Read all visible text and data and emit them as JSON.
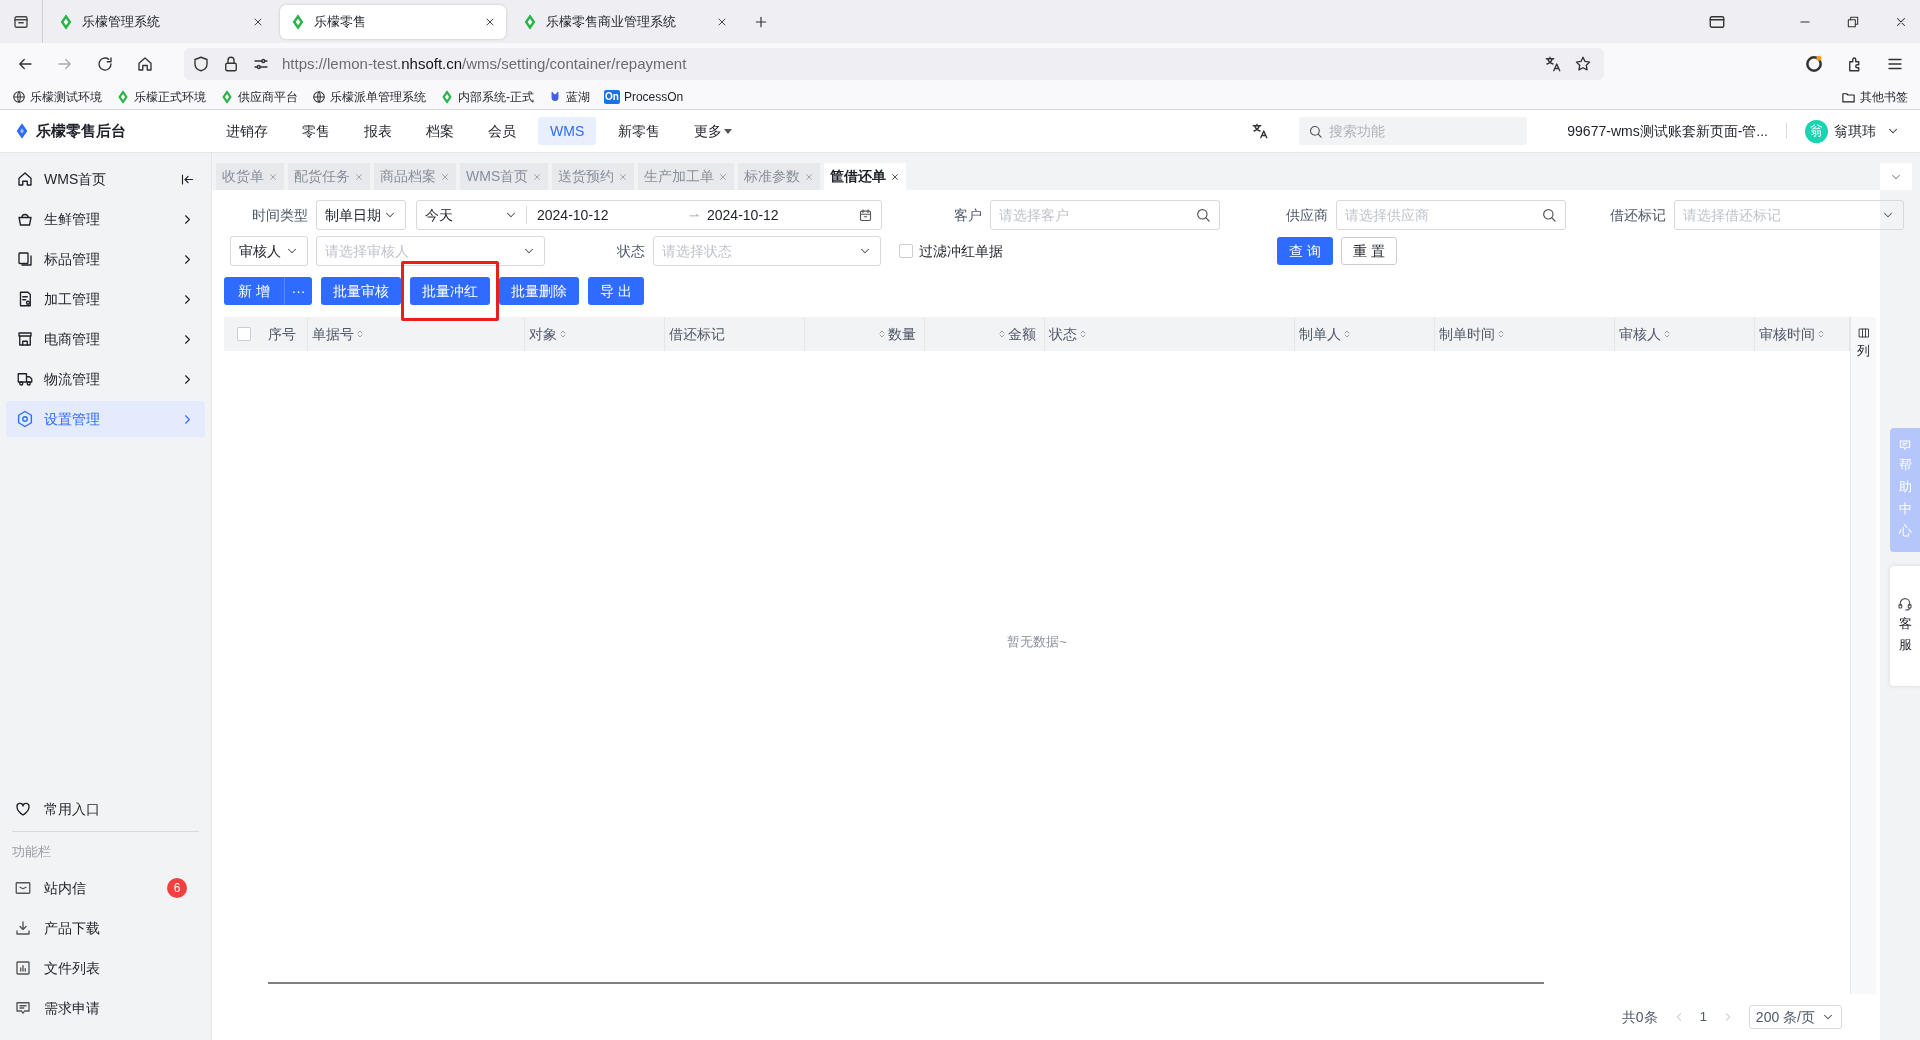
{
  "browser": {
    "tabs": [
      {
        "title": "乐檬管理系统",
        "selected": false
      },
      {
        "title": "乐檬零售",
        "selected": true
      },
      {
        "title": "乐檬零售商业管理系统",
        "selected": false
      }
    ],
    "url": [
      {
        "text": "https://lemon-test.",
        "strong": false
      },
      {
        "text": "nhsoft.cn",
        "strong": true
      },
      {
        "text": "/wms/setting/container/repayment",
        "strong": false
      }
    ],
    "bookmarks": [
      {
        "label": "乐檬测试环境"
      },
      {
        "label": "乐檬正式环境"
      },
      {
        "label": "供应商平台"
      },
      {
        "label": "乐檬派单管理系统"
      },
      {
        "label": "内部系统-正式"
      },
      {
        "label": "蓝湖"
      },
      {
        "label": "ProcessOn",
        "badge": "On"
      }
    ],
    "other_bookmarks": "其他书签"
  },
  "header": {
    "logo": "乐檬零售后台",
    "nav": [
      {
        "label": "进销存",
        "selected": false
      },
      {
        "label": "零售",
        "selected": false
      },
      {
        "label": "报表",
        "selected": false
      },
      {
        "label": "档案",
        "selected": false
      },
      {
        "label": "会员",
        "selected": false
      },
      {
        "label": "WMS",
        "selected": true
      },
      {
        "label": "新零售",
        "selected": false
      },
      {
        "label": "更多",
        "selected": false,
        "kind": "dropdown"
      }
    ],
    "search": {
      "placeholder": "搜索功能"
    },
    "account": "99677-wms测试账套新页面-管...",
    "user": {
      "avatar": "翁",
      "name": "翁琪玮"
    }
  },
  "sidebar": {
    "items": [
      {
        "label": "WMS首页",
        "selected": false,
        "kind": "collapse"
      },
      {
        "label": "生鲜管理",
        "selected": false,
        "kind": "expand"
      },
      {
        "label": "标品管理",
        "selected": false,
        "kind": "expand"
      },
      {
        "label": "加工管理",
        "selected": false,
        "kind": "expand"
      },
      {
        "label": "电商管理",
        "selected": false,
        "kind": "expand"
      },
      {
        "label": "物流管理",
        "selected": false,
        "kind": "expand"
      },
      {
        "label": "设置管理",
        "selected": true,
        "kind": "expand"
      }
    ],
    "shortcut": "常用入口",
    "section": "功能栏",
    "tools": [
      {
        "label": "站内信",
        "badge": "6"
      },
      {
        "label": "产品下载"
      },
      {
        "label": "文件列表"
      },
      {
        "label": "需求申请"
      }
    ]
  },
  "page_tabs": [
    {
      "label": "收货单",
      "selected": false
    },
    {
      "label": "配货任务",
      "selected": false
    },
    {
      "label": "商品档案",
      "selected": false
    },
    {
      "label": "WMS首页",
      "selected": false
    },
    {
      "label": "送货预约",
      "selected": false
    },
    {
      "label": "生产加工单",
      "selected": false
    },
    {
      "label": "标准参数",
      "selected": false
    },
    {
      "label": "筐借还单",
      "selected": true
    }
  ],
  "filters": {
    "time_type": {
      "label": "时间类型",
      "value": "制单日期"
    },
    "period": "今天",
    "date_from": "2024-10-12",
    "date_to": "2024-10-12",
    "customer": {
      "label": "客户",
      "placeholder": "请选择客户"
    },
    "supplier": {
      "label": "供应商",
      "placeholder": "请选择供应商"
    },
    "borrow_mark": {
      "label": "借还标记",
      "placeholder": "请选择借还标记"
    },
    "person_type": "审核人",
    "person": {
      "placeholder": "请选择审核人"
    },
    "status": {
      "label": "状态",
      "placeholder": "请选择状态"
    },
    "filter_red": {
      "label": "过滤冲红单据",
      "checked": false
    },
    "query": "查 询",
    "reset": "重 置"
  },
  "actions": [
    {
      "label": "新 增",
      "more": "···",
      "highlighted": false
    },
    {
      "label": "批量审核",
      "highlighted": false
    },
    {
      "label": "批量冲红",
      "highlighted": true
    },
    {
      "label": "批量删除",
      "highlighted": false
    },
    {
      "label": "导 出",
      "highlighted": false
    }
  ],
  "table": {
    "select_all_checked": false,
    "columns": [
      {
        "label": "序号",
        "sortable": false,
        "kind": "text"
      },
      {
        "label": "单据号",
        "sortable": true,
        "kind": "text"
      },
      {
        "label": "对象",
        "sortable": true,
        "kind": "text"
      },
      {
        "label": "借还标记",
        "sortable": false,
        "kind": "text"
      },
      {
        "label": "数量",
        "sortable": true,
        "kind": "number"
      },
      {
        "label": "金额",
        "sortable": true,
        "kind": "number"
      },
      {
        "label": "状态",
        "sortable": true,
        "kind": "text"
      },
      {
        "label": "制单人",
        "sortable": true,
        "kind": "text"
      },
      {
        "label": "制单时间",
        "sortable": true,
        "kind": "text"
      },
      {
        "label": "审核人",
        "sortable": true,
        "kind": "text"
      },
      {
        "label": "审核时间",
        "sortable": true,
        "kind": "text"
      }
    ],
    "column_settings": "列",
    "empty": "暂无数据~"
  },
  "pagination": {
    "total": "共0条",
    "page": "1",
    "page_size": "200 条/页"
  },
  "float": {
    "help": "帮助中心",
    "service": "客服"
  }
}
